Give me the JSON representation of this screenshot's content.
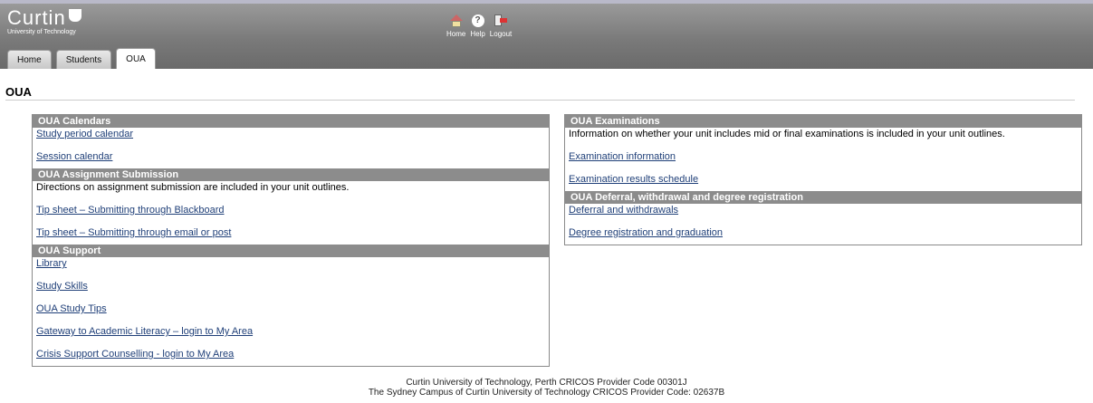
{
  "brand": {
    "name": "Curtin",
    "subtitle": "University of Technology"
  },
  "toolbar": {
    "home_label": "Home",
    "help_label": "Help",
    "logout_label": "Logout",
    "help_glyph": "?"
  },
  "tabs": [
    {
      "label": "Home",
      "active": false
    },
    {
      "label": "Students",
      "active": false
    },
    {
      "label": "OUA",
      "active": true
    }
  ],
  "page_title": "OUA",
  "left_column": {
    "calendars": {
      "heading": "OUA Calendars",
      "links": [
        " Study period calendar",
        "Session calendar"
      ]
    },
    "assignment": {
      "heading": "OUA Assignment Submission",
      "text": "Directions on assignment submission are included in your unit outlines.",
      "links": [
        "Tip sheet – Submitting through Blackboard",
        "Tip sheet – Submitting through email or post"
      ]
    },
    "support": {
      "heading": "OUA Support",
      "links": [
        "Library",
        "Study Skills",
        "OUA Study Tips",
        "Gateway to Academic Literacy – login to My Area",
        "Crisis Support Counselling - login to My Area"
      ]
    }
  },
  "right_column": {
    "examinations": {
      "heading": "OUA Examinations",
      "text": "Information on whether your unit includes mid or final examinations is included in your unit outlines.",
      "links": [
        "Examination information",
        "Examination results schedule"
      ]
    },
    "deferral": {
      "heading": "OUA Deferral, withdrawal and degree registration",
      "links": [
        " Deferral and withdrawals",
        "Degree registration and graduation"
      ]
    }
  },
  "footer": {
    "line1": "Curtin University of Technology, Perth CRICOS Provider Code 00301J",
    "line2": "The Sydney Campus of Curtin University of Technology CRICOS Provider Code: 02637B"
  },
  "colors": {
    "header_bg": "#7a7a7a",
    "section_head_bg": "#8c8c8c",
    "link": "#1f3f78"
  }
}
